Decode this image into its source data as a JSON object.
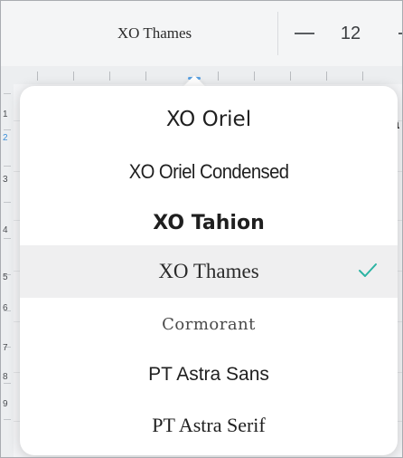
{
  "toolbar": {
    "font_name": "XO Thames",
    "font_size": "12",
    "decrease_icon": "minus-icon",
    "increase_icon": "plus-icon"
  },
  "document": {
    "line_numbers": [
      "1",
      "2",
      "3",
      "4",
      "5",
      "6",
      "7",
      "8",
      "9"
    ],
    "active_line": "2",
    "fragment_text": "a"
  },
  "font_menu": {
    "options": [
      {
        "label": "XO Oriel",
        "selected": false
      },
      {
        "label": "XO Oriel Condensed",
        "selected": false
      },
      {
        "label": "XO Tahion",
        "selected": false
      },
      {
        "label": "XO Thames",
        "selected": true
      },
      {
        "label": "Cormorant",
        "selected": false
      },
      {
        "label": "PT Astra Sans",
        "selected": false
      },
      {
        "label": "PT Astra Serif",
        "selected": false
      }
    ],
    "check_icon": "checkmark-icon"
  },
  "colors": {
    "accent": "#2bb3a3",
    "active_line_number": "#3b8ed8",
    "selected_row_bg": "#efeff0"
  }
}
